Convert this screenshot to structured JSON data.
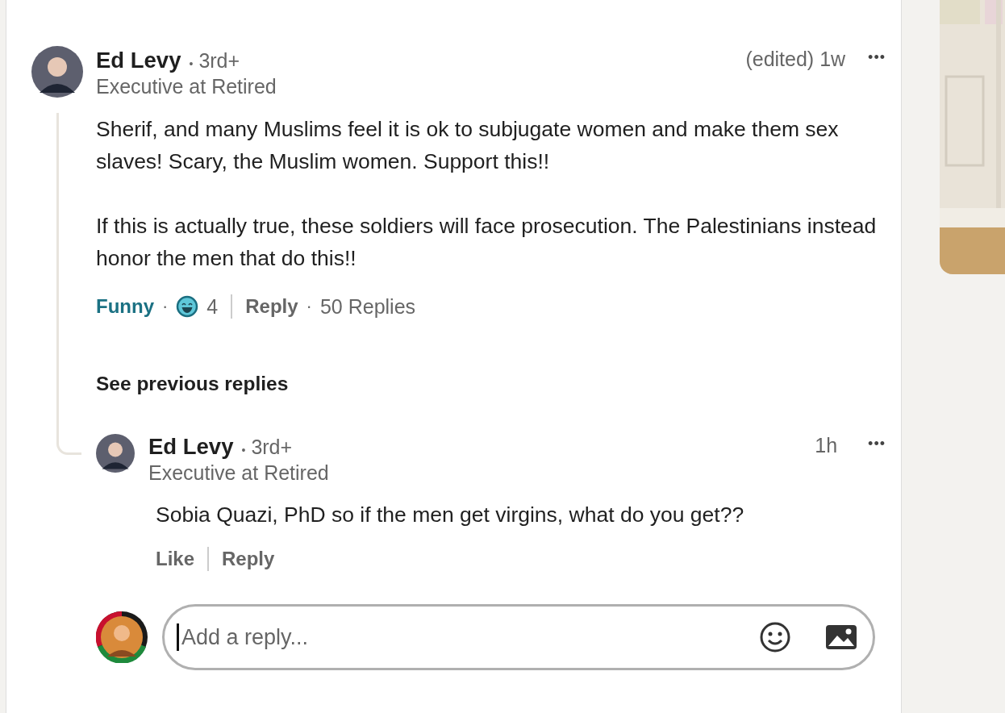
{
  "comment": {
    "author": "Ed Levy",
    "bullet": "•",
    "degree": "3rd+",
    "headline": "Executive at Retired",
    "time": "(edited) 1w",
    "menu": "•••",
    "paragraphs": [
      "Sherif, and many Muslims feel it is ok to subjugate women and make them sex slaves! Scary, the Muslim women. Support this!!",
      "If this is actually true, these soldiers will face prosecution. The Palestinians instead honor the men that do this!!"
    ],
    "reaction": {
      "label": "Funny",
      "separator": "·",
      "selected": true,
      "count": "4"
    },
    "reply_label": "Reply",
    "reply_separator": "·",
    "replies_count": "50 Replies"
  },
  "see_previous": "See previous replies",
  "reply": {
    "author": "Ed Levy",
    "bullet": "•",
    "degree": "3rd+",
    "headline": "Executive at Retired",
    "time": "1h",
    "menu": "•••",
    "text": "Sobia Quazi, PhD so if the men get virgins, what do you get??",
    "like_label": "Like",
    "reply_label": "Reply"
  },
  "reply_box": {
    "placeholder": "Add a reply..."
  }
}
